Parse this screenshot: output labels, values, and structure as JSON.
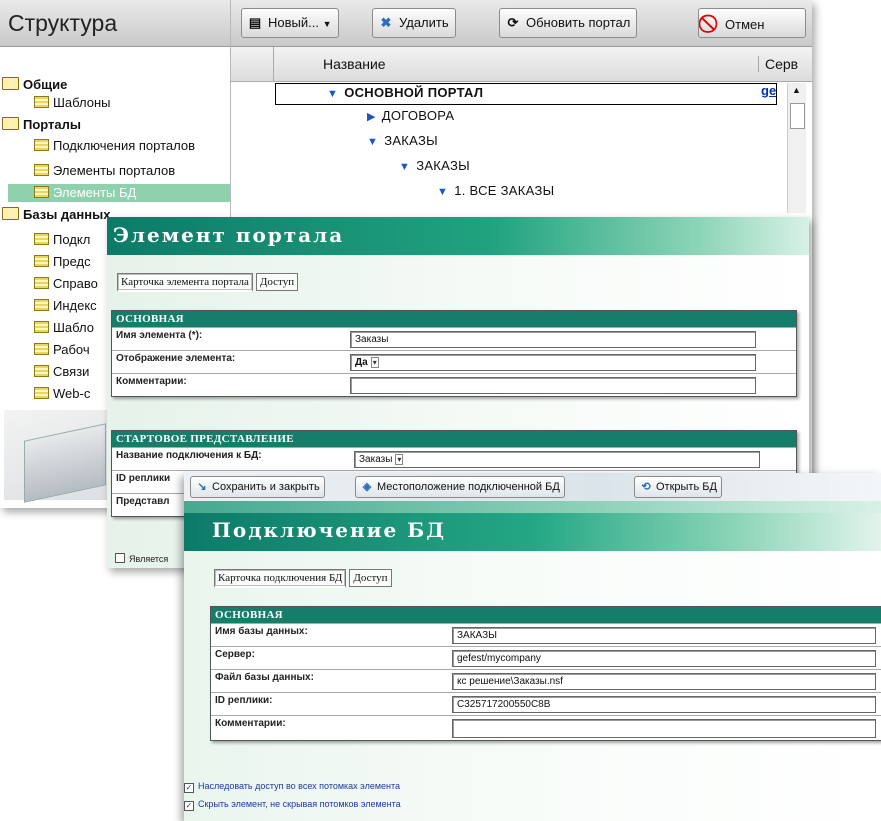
{
  "structure_window": {
    "title": "Структура",
    "tree": [
      {
        "label": "Общие",
        "icon": "folder-icon",
        "bold": true
      },
      {
        "label": "Шаблоны",
        "icon": "table-icon"
      },
      {
        "label": "Порталы",
        "icon": "folder-icon",
        "bold": true
      },
      {
        "label": "Подключения порталов",
        "icon": "table-icon"
      },
      {
        "label": "Элементы порталов",
        "icon": "table-icon"
      },
      {
        "label": "Элементы БД",
        "icon": "table-icon",
        "selected": true
      },
      {
        "label": "Базы данных",
        "icon": "folder-icon",
        "bold": true
      },
      {
        "label": "Подкл",
        "icon": "table-icon"
      },
      {
        "label": "Предс",
        "icon": "table-icon"
      },
      {
        "label": "Справо",
        "icon": "table-icon"
      },
      {
        "label": "Индекс",
        "icon": "table-icon"
      },
      {
        "label": "Шабло",
        "icon": "table-icon"
      },
      {
        "label": "Рабоч",
        "icon": "table-icon"
      },
      {
        "label": "Связи",
        "icon": "table-icon"
      },
      {
        "label": "Web-c",
        "icon": "table-icon"
      }
    ],
    "toolbar": {
      "new_label": "Новый...",
      "delete_label": "Удалить",
      "refresh_label": "Обновить портал",
      "cancel_label": "Отмен"
    },
    "grid": {
      "columns": [
        "Название",
        "Серв"
      ],
      "rows": [
        {
          "label": "ОСНОВНОЙ ПОРТАЛ",
          "expanded": true,
          "bold": true,
          "server": "ge"
        },
        {
          "label": "ДОГОВОРА",
          "expanded": false
        },
        {
          "label": "ЗАКАЗЫ",
          "expanded": true
        },
        {
          "label": "ЗАКАЗЫ",
          "expanded": true
        },
        {
          "label": "1. ВСЕ ЗАКАЗЫ",
          "expanded": true
        }
      ]
    }
  },
  "element_window": {
    "title": "Элемент портала",
    "tabs": [
      "Карточка элемента портала",
      "Доступ"
    ],
    "section_main": {
      "title": "ОСНОВНАЯ",
      "fields": [
        {
          "label": "Имя элемента (*):",
          "value": "Заказы"
        },
        {
          "label": "Отображение элемента:",
          "value": "Да"
        },
        {
          "label": "Комментарии:",
          "value": ""
        }
      ]
    },
    "section_start": {
      "title": "СТАРТОВОЕ ПРЕДСТАВЛЕНИЕ",
      "fields": [
        {
          "label": "Название подключения к БД:",
          "value": "Заказы"
        },
        {
          "label": "ID реплики",
          "value": ""
        },
        {
          "label": "Представл",
          "value": ""
        }
      ]
    },
    "checkbox_label": "Является"
  },
  "db_window": {
    "toolbar": {
      "save_close_label": "Сохранить и закрыть",
      "location_label": "Местоположение подключенной БД",
      "open_db_label": "Открыть БД"
    },
    "title": "Подключение БД",
    "tabs": [
      "Карточка подключения БД",
      "Доступ"
    ],
    "section": {
      "title": "ОСНОВНАЯ",
      "fields": [
        {
          "label": "Имя базы данных:",
          "value": "ЗАКАЗЫ"
        },
        {
          "label": "Сервер:",
          "value": "gefest/mycompany"
        },
        {
          "label": "Файл базы данных:",
          "value": "кс решение\\Заказы.nsf"
        },
        {
          "label": "ID реплики:",
          "value": "C325717200550C8B"
        },
        {
          "label": "Комментарии:",
          "value": ""
        }
      ]
    },
    "checkboxes": [
      {
        "label": "Наследовать доступ во всех потомках элемента",
        "checked": true
      },
      {
        "label": "Скрыть элемент, не скрывая потомков элемента",
        "checked": true
      }
    ]
  },
  "colors": {
    "accent_green": "#167d6b",
    "selection_green": "#8fd1ad",
    "link_blue": "#0033aa"
  }
}
